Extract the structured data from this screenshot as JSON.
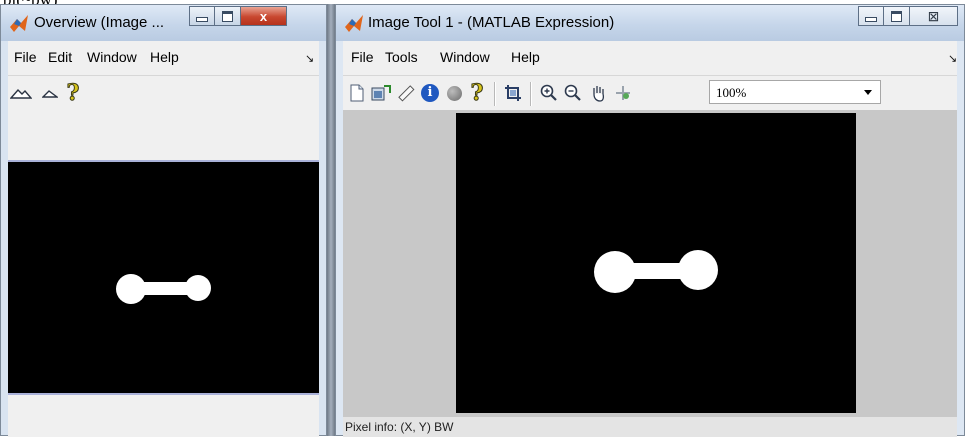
{
  "page_fragment": {
    "text": "bl(~bw)"
  },
  "overview_window": {
    "title": "Overview (Image ...",
    "menu": [
      "File",
      "Edit",
      "Window",
      "Help"
    ],
    "dock_glyph": "↘",
    "toolbar": {
      "icons": [
        "mountain-large-icon",
        "mountain-small-icon",
        "help-icon"
      ],
      "help_glyph": "?"
    }
  },
  "imagetool_window": {
    "title": "Image Tool 1 - (MATLAB Expression)",
    "menu": [
      "File",
      "Tools",
      "Window",
      "Help"
    ],
    "dock_glyph": "↘",
    "toolbar": {
      "icons": [
        "new-figure-icon",
        "export-image-icon",
        "measure-distance-icon",
        "image-info-icon",
        "adjust-contrast-icon",
        "help-icon",
        "crop-icon",
        "zoom-in-icon",
        "zoom-out-icon",
        "pan-icon",
        "overview-icon"
      ],
      "help_glyph": "?",
      "info_glyph": "i",
      "zoom_value": "100%"
    },
    "status": {
      "pixel_info": "Pixel info: (X, Y)  BW"
    }
  },
  "caption_buttons": {
    "close_glyph": "x",
    "close_glyph_alt": "⊠"
  },
  "colors": {
    "image_background": "#000000",
    "foreground_blob": "#ffffff",
    "accent": "#1f58c0"
  }
}
